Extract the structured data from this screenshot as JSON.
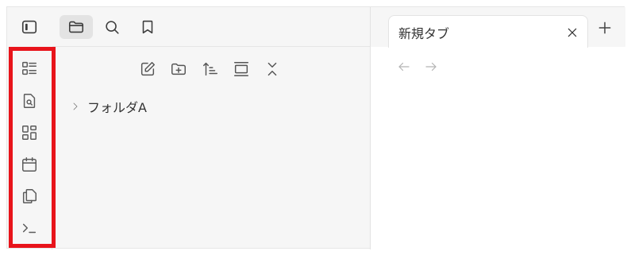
{
  "app": {
    "accent_highlight": "#e8141b"
  },
  "ribbon": {
    "items": [
      {
        "icon": "kanban-list-icon"
      },
      {
        "icon": "file-search-icon"
      },
      {
        "icon": "grid-icon"
      },
      {
        "icon": "calendar-icon"
      },
      {
        "icon": "copy-files-icon"
      },
      {
        "icon": "terminal-icon"
      }
    ]
  },
  "pane_header": {
    "tabs": [
      {
        "icon": "folder-icon",
        "active": true
      },
      {
        "icon": "search-icon",
        "active": false
      },
      {
        "icon": "bookmark-icon",
        "active": false
      }
    ]
  },
  "file_explorer": {
    "actions": [
      {
        "icon": "new-note-icon"
      },
      {
        "icon": "new-folder-icon"
      },
      {
        "icon": "sort-icon"
      },
      {
        "icon": "auto-reveal-icon"
      },
      {
        "icon": "collapse-all-icon"
      }
    ],
    "tree": [
      {
        "label": "フォルダA",
        "expanded": false
      }
    ]
  },
  "editor": {
    "tabs": [
      {
        "title": "新規タブ"
      }
    ]
  }
}
